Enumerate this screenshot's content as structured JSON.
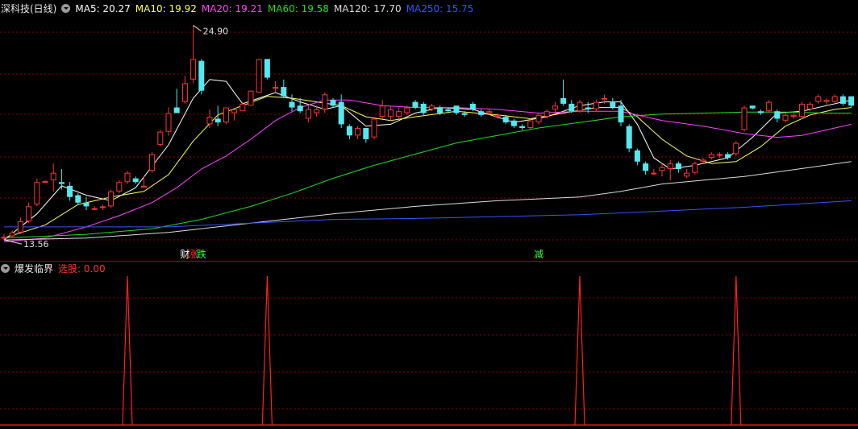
{
  "main_panel": {
    "title": "深科技(日线)",
    "ma_labels": [
      {
        "label": "MA5: 20.27",
        "color": "#ffffff"
      },
      {
        "label": "MA10: 19.92",
        "color": "#ffff66"
      },
      {
        "label": "MA20: 19.21",
        "color": "#ff44ff"
      },
      {
        "label": "MA60: 19.58",
        "color": "#22dd22"
      },
      {
        "label": "MA120: 17.70",
        "color": "#dddddd"
      },
      {
        "label": "MA250: 15.75",
        "color": "#3355ff"
      }
    ],
    "high_label": "24.90",
    "low_label": "13.56",
    "markers": [
      {
        "text": "财",
        "color": "#ffffff"
      },
      {
        "text": "涨",
        "color": "#ff3333"
      },
      {
        "text": "跌",
        "color": "#33ff33"
      },
      {
        "text": "减",
        "color": "#33ff33"
      }
    ]
  },
  "sub_panel": {
    "title": "爆发临界",
    "signal_label": "选股: 0.00",
    "signal_color": "#ff3030"
  },
  "colors": {
    "up": "#ff3333",
    "down": "#55e8ee",
    "grid": "#8b0000",
    "divider": "#b00000"
  },
  "chart_data": {
    "type": "candlestick",
    "ylim": [
      12.8,
      25.4
    ],
    "candles": [
      [
        13.5,
        13.7,
        13.4,
        13.56
      ],
      [
        13.6,
        13.9,
        13.5,
        13.8
      ],
      [
        13.8,
        14.6,
        13.7,
        14.4
      ],
      [
        14.4,
        15.4,
        14.3,
        15.2
      ],
      [
        15.3,
        16.7,
        15.2,
        16.5
      ],
      [
        16.5,
        16.6,
        16.5,
        16.55
      ],
      [
        16.6,
        17.5,
        16.0,
        17.0
      ],
      [
        16.5,
        17.2,
        16.1,
        16.4
      ],
      [
        16.3,
        16.5,
        15.5,
        15.7
      ],
      [
        15.8,
        15.9,
        15.3,
        15.4
      ],
      [
        15.4,
        15.7,
        15.0,
        15.2
      ],
      [
        15.1,
        15.2,
        15.0,
        15.1
      ],
      [
        15.2,
        15.3,
        15.0,
        15.2
      ],
      [
        15.2,
        16.1,
        15.1,
        16.0
      ],
      [
        16.0,
        16.6,
        15.9,
        16.5
      ],
      [
        16.5,
        17.1,
        16.4,
        17.0
      ],
      [
        16.7,
        16.8,
        16.4,
        16.5
      ],
      [
        16.2,
        16.8,
        16.2,
        16.3
      ],
      [
        17.1,
        18.1,
        17.0,
        18.0
      ],
      [
        18.5,
        19.3,
        18.4,
        19.2
      ],
      [
        19.2,
        20.5,
        19.0,
        20.2
      ],
      [
        20.5,
        21.5,
        20.2,
        20.2
      ],
      [
        20.8,
        22.2,
        20.7,
        21.8
      ],
      [
        22.0,
        24.9,
        21.8,
        23.1
      ],
      [
        23.0,
        23.1,
        21.2,
        21.4
      ],
      [
        19.6,
        20.4,
        19.4,
        20.0
      ],
      [
        19.9,
        20.6,
        19.5,
        19.7
      ],
      [
        19.7,
        20.5,
        19.6,
        20.5
      ],
      [
        20.2,
        20.4,
        19.8,
        20.4
      ],
      [
        20.3,
        20.8,
        20.3,
        20.7
      ],
      [
        20.6,
        21.4,
        20.6,
        21.4
      ],
      [
        21.3,
        23.1,
        21.3,
        23.1
      ],
      [
        23.1,
        23.1,
        22.0,
        22.1
      ],
      [
        21.5,
        21.9,
        21.3,
        21.6
      ],
      [
        21.6,
        22.0,
        21.0,
        21.1
      ],
      [
        20.8,
        21.2,
        20.3,
        20.5
      ],
      [
        20.6,
        21.0,
        20.2,
        20.3
      ],
      [
        19.9,
        20.6,
        19.7,
        20.4
      ],
      [
        20.2,
        20.6,
        20.0,
        20.4
      ],
      [
        20.4,
        21.3,
        20.2,
        21.2
      ],
      [
        20.9,
        21.0,
        20.5,
        20.6
      ],
      [
        20.8,
        21.2,
        19.4,
        19.6
      ],
      [
        19.5,
        19.6,
        18.8,
        19.0
      ],
      [
        19.0,
        19.5,
        18.8,
        19.4
      ],
      [
        19.4,
        19.4,
        18.6,
        18.8
      ],
      [
        18.9,
        20.0,
        18.8,
        19.9
      ],
      [
        20.0,
        20.9,
        19.9,
        20.6
      ],
      [
        20.0,
        20.6,
        19.8,
        20.4
      ],
      [
        20.0,
        20.5,
        19.9,
        20.3
      ],
      [
        20.2,
        20.6,
        20.1,
        20.5
      ],
      [
        20.8,
        20.9,
        20.4,
        20.5
      ],
      [
        20.7,
        20.8,
        20.1,
        20.2
      ],
      [
        20.4,
        20.7,
        20.3,
        20.6
      ],
      [
        20.5,
        20.6,
        20.1,
        20.2
      ],
      [
        20.4,
        20.5,
        20.2,
        20.3
      ],
      [
        20.6,
        20.6,
        20.1,
        20.2
      ],
      [
        20.2,
        20.3,
        20.0,
        20.1
      ],
      [
        20.7,
        20.8,
        20.3,
        20.4
      ],
      [
        20.3,
        20.4,
        20.0,
        20.1
      ],
      [
        20.2,
        20.4,
        20.1,
        20.3
      ],
      [
        20.0,
        20.2,
        19.9,
        20.1
      ],
      [
        20.0,
        20.1,
        19.6,
        19.7
      ],
      [
        19.8,
        19.9,
        19.4,
        19.5
      ],
      [
        19.5,
        19.6,
        19.3,
        19.4
      ],
      [
        19.4,
        19.9,
        19.3,
        19.8
      ],
      [
        19.7,
        20.2,
        19.6,
        20.1
      ],
      [
        20.0,
        20.4,
        19.9,
        20.3
      ],
      [
        20.4,
        20.8,
        20.2,
        20.6
      ],
      [
        21.0,
        22.0,
        20.6,
        20.7
      ],
      [
        20.7,
        20.9,
        20.2,
        20.3
      ],
      [
        20.3,
        20.9,
        20.2,
        20.8
      ],
      [
        20.5,
        20.8,
        20.2,
        20.4
      ],
      [
        20.4,
        20.9,
        20.3,
        20.8
      ],
      [
        20.9,
        21.2,
        20.7,
        21.0
      ],
      [
        20.8,
        21.0,
        20.4,
        20.5
      ],
      [
        20.6,
        20.9,
        19.5,
        19.7
      ],
      [
        19.5,
        19.6,
        18.1,
        18.3
      ],
      [
        18.2,
        18.3,
        17.4,
        17.6
      ],
      [
        17.5,
        17.6,
        16.9,
        17.1
      ],
      [
        17.0,
        17.2,
        16.9,
        17.0
      ],
      [
        17.1,
        17.5,
        16.8,
        17.3
      ],
      [
        17.2,
        17.7,
        16.6,
        17.5
      ],
      [
        17.5,
        17.6,
        17.0,
        17.2
      ],
      [
        16.8,
        17.2,
        16.7,
        17.0
      ],
      [
        17.0,
        17.6,
        16.9,
        17.5
      ],
      [
        17.6,
        17.8,
        17.5,
        17.7
      ],
      [
        17.8,
        18.1,
        17.7,
        18.0
      ],
      [
        18.0,
        18.1,
        17.8,
        18.0
      ],
      [
        18.0,
        18.1,
        17.7,
        17.8
      ],
      [
        18.0,
        18.7,
        17.9,
        18.6
      ],
      [
        19.3,
        20.6,
        19.2,
        20.5
      ],
      [
        20.6,
        20.6,
        20.4,
        20.45
      ],
      [
        20.3,
        20.4,
        20.1,
        20.2
      ],
      [
        20.3,
        20.9,
        20.2,
        20.8
      ],
      [
        20.3,
        20.4,
        19.7,
        19.9
      ],
      [
        19.8,
        20.2,
        19.7,
        20.1
      ],
      [
        20.0,
        20.3,
        19.9,
        20.1
      ],
      [
        20.0,
        20.8,
        19.9,
        20.7
      ],
      [
        20.4,
        20.8,
        20.3,
        20.7
      ],
      [
        20.8,
        21.2,
        20.7,
        21.1
      ],
      [
        20.8,
        21.0,
        20.6,
        20.9
      ],
      [
        20.8,
        21.2,
        20.7,
        21.1
      ],
      [
        21.1,
        21.2,
        20.6,
        20.7
      ],
      [
        21.1,
        21.1,
        20.5,
        20.6
      ]
    ],
    "moving_averages": [
      {
        "name": "MA5",
        "color": "#ffffff",
        "points": [
          [
            0,
            13.4
          ],
          [
            4,
            14.8
          ],
          [
            7,
            16.3
          ],
          [
            10,
            15.8
          ],
          [
            13,
            15.5
          ],
          [
            16,
            16.2
          ],
          [
            20,
            18.5
          ],
          [
            23,
            21.0
          ],
          [
            25,
            22.0
          ],
          [
            27,
            21.9
          ],
          [
            29,
            20.7
          ],
          [
            31,
            21.0
          ],
          [
            33,
            21.3
          ],
          [
            36,
            20.8
          ],
          [
            39,
            20.4
          ],
          [
            41,
            20.6
          ],
          [
            44,
            19.5
          ],
          [
            47,
            19.6
          ],
          [
            50,
            20.2
          ],
          [
            53,
            20.5
          ],
          [
            57,
            20.4
          ],
          [
            62,
            19.7
          ],
          [
            66,
            20.0
          ],
          [
            70,
            20.6
          ],
          [
            73,
            20.8
          ],
          [
            75,
            20.8
          ],
          [
            77,
            19.6
          ],
          [
            79,
            17.8
          ],
          [
            81,
            17.2
          ],
          [
            84,
            17.4
          ],
          [
            88,
            17.8
          ],
          [
            91,
            18.9
          ],
          [
            94,
            20.2
          ],
          [
            97,
            20.3
          ],
          [
            100,
            20.6
          ],
          [
            103,
            20.9
          ]
        ]
      },
      {
        "name": "MA10",
        "color": "#ffff66",
        "points": [
          [
            0,
            13.5
          ],
          [
            5,
            14.2
          ],
          [
            9,
            15.3
          ],
          [
            13,
            15.7
          ],
          [
            17,
            16.0
          ],
          [
            20,
            16.9
          ],
          [
            23,
            18.7
          ],
          [
            26,
            20.1
          ],
          [
            29,
            20.6
          ],
          [
            32,
            21.1
          ],
          [
            35,
            21.0
          ],
          [
            38,
            20.8
          ],
          [
            41,
            20.6
          ],
          [
            44,
            20.0
          ],
          [
            47,
            19.8
          ],
          [
            50,
            20.0
          ],
          [
            55,
            20.3
          ],
          [
            60,
            20.1
          ],
          [
            64,
            19.9
          ],
          [
            68,
            20.2
          ],
          [
            72,
            20.5
          ],
          [
            75,
            20.5
          ],
          [
            77,
            20.0
          ],
          [
            80,
            18.8
          ],
          [
            83,
            17.9
          ],
          [
            86,
            17.5
          ],
          [
            89,
            17.6
          ],
          [
            92,
            18.4
          ],
          [
            95,
            19.5
          ],
          [
            98,
            20.1
          ],
          [
            101,
            20.4
          ],
          [
            103,
            20.5
          ]
        ]
      },
      {
        "name": "MA20",
        "color": "#ff44ff",
        "points": [
          [
            0,
            13.3
          ],
          [
            5,
            13.5
          ],
          [
            10,
            14.1
          ],
          [
            14,
            14.7
          ],
          [
            18,
            15.4
          ],
          [
            21,
            16.2
          ],
          [
            24,
            17.2
          ],
          [
            27,
            17.9
          ],
          [
            30,
            18.8
          ],
          [
            33,
            19.8
          ],
          [
            36,
            20.5
          ],
          [
            39,
            20.9
          ],
          [
            42,
            20.9
          ],
          [
            46,
            20.6
          ],
          [
            50,
            20.5
          ],
          [
            55,
            20.5
          ],
          [
            60,
            20.4
          ],
          [
            65,
            20.2
          ],
          [
            70,
            20.3
          ],
          [
            75,
            20.3
          ],
          [
            80,
            19.8
          ],
          [
            85,
            19.5
          ],
          [
            90,
            19.1
          ],
          [
            94,
            18.9
          ],
          [
            97,
            19.0
          ],
          [
            100,
            19.3
          ],
          [
            103,
            19.6
          ]
        ]
      },
      {
        "name": "MA60",
        "color": "#22dd22",
        "points": [
          [
            0,
            13.5
          ],
          [
            10,
            13.7
          ],
          [
            18,
            14.0
          ],
          [
            24,
            14.5
          ],
          [
            30,
            15.2
          ],
          [
            35,
            15.9
          ],
          [
            40,
            16.7
          ],
          [
            45,
            17.4
          ],
          [
            50,
            18.0
          ],
          [
            55,
            18.6
          ],
          [
            60,
            19.0
          ],
          [
            65,
            19.4
          ],
          [
            70,
            19.7
          ],
          [
            75,
            20.0
          ],
          [
            80,
            20.15
          ],
          [
            85,
            20.2
          ],
          [
            90,
            20.25
          ],
          [
            95,
            20.25
          ],
          [
            100,
            20.2
          ],
          [
            103,
            20.2
          ]
        ]
      },
      {
        "name": "MA120",
        "color": "#dddddd",
        "points": [
          [
            0,
            13.4
          ],
          [
            10,
            13.5
          ],
          [
            20,
            13.8
          ],
          [
            30,
            14.3
          ],
          [
            40,
            14.8
          ],
          [
            50,
            15.2
          ],
          [
            60,
            15.5
          ],
          [
            70,
            15.7
          ],
          [
            75,
            16.0
          ],
          [
            80,
            16.4
          ],
          [
            85,
            16.6
          ],
          [
            90,
            16.8
          ],
          [
            95,
            17.1
          ],
          [
            103,
            17.6
          ]
        ]
      },
      {
        "name": "MA250",
        "color": "#3355ff",
        "points": [
          [
            0,
            14.1
          ],
          [
            20,
            14.1
          ],
          [
            30,
            14.3
          ],
          [
            40,
            14.5
          ],
          [
            50,
            14.55
          ],
          [
            60,
            14.65
          ],
          [
            70,
            14.75
          ],
          [
            80,
            14.95
          ],
          [
            90,
            15.15
          ],
          [
            103,
            15.5
          ]
        ]
      }
    ],
    "marker_positions": [
      22,
      23,
      24,
      65
    ],
    "signal": {
      "name": "选股",
      "ylim": [
        0,
        1
      ],
      "spikes": [
        15,
        32,
        70,
        89
      ]
    }
  }
}
